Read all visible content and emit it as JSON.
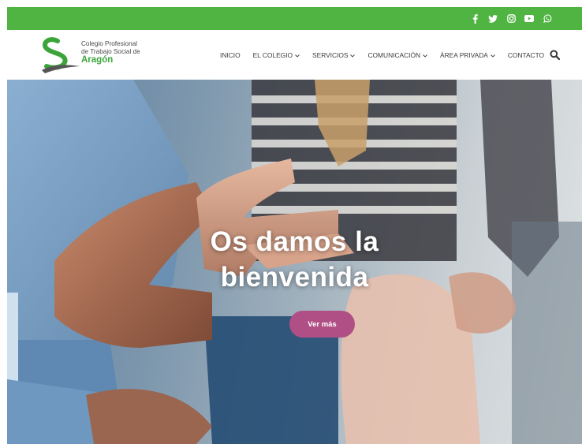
{
  "colors": {
    "topbar": "#4fb442",
    "brand_green": "#3ba53a",
    "cta_background": "#b04f86",
    "nav_text": "#3c3c3c"
  },
  "social": [
    {
      "name": "facebook-icon"
    },
    {
      "name": "twitter-icon"
    },
    {
      "name": "instagram-icon"
    },
    {
      "name": "youtube-icon"
    },
    {
      "name": "whatsapp-icon"
    }
  ],
  "logo": {
    "line1": "Colegio Profesional",
    "line2": "de Trabajo Social de",
    "line3": "Aragón"
  },
  "nav": {
    "items": [
      {
        "label": "INICIO",
        "dropdown": false
      },
      {
        "label": "EL COLEGIO",
        "dropdown": true
      },
      {
        "label": "SERVICIOS",
        "dropdown": true
      },
      {
        "label": "COMUNICACIÓN",
        "dropdown": true
      },
      {
        "label": "ÁREA PRIVADA",
        "dropdown": true
      },
      {
        "label": "CONTACTO",
        "dropdown": false
      }
    ],
    "search_icon": "search-icon"
  },
  "hero": {
    "title_line1": "Os damos la",
    "title_line2": "bienvenida",
    "cta_label": "Ver más"
  }
}
